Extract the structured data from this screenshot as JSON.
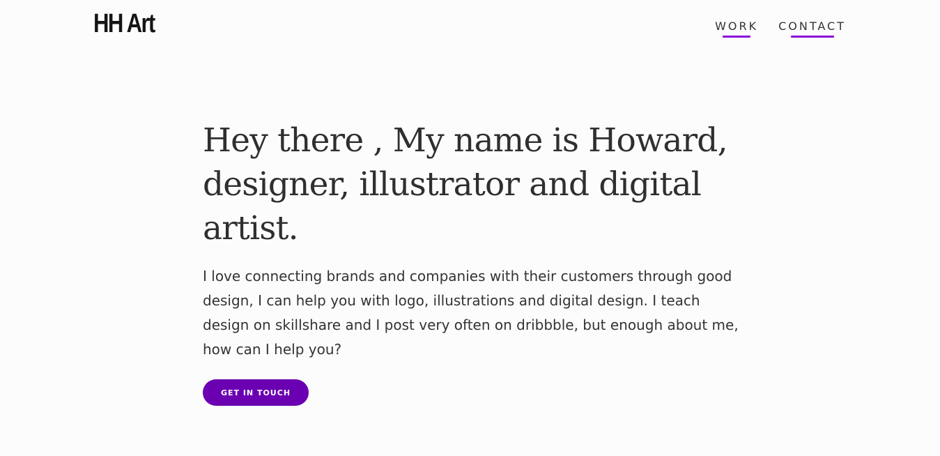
{
  "header": {
    "logo": "HH Art",
    "nav": [
      {
        "label": "WORK"
      },
      {
        "label": "CONTACT"
      }
    ]
  },
  "hero": {
    "title": "Hey there , My name is Howard, designer, illustrator and digital artist.",
    "text": "I love connecting brands and companies with their customers through good design, I can help you with logo, illustrations and digital design. I teach design on skillshare and I post very often on dribbble, but enough about me, how can I help you?",
    "cta_label": "GET IN TOUCH"
  },
  "colors": {
    "background": "#fcfcfd",
    "accent": "#6a00b1",
    "nav_underline": "#8a0ad8",
    "text": "#2b2b2b"
  }
}
